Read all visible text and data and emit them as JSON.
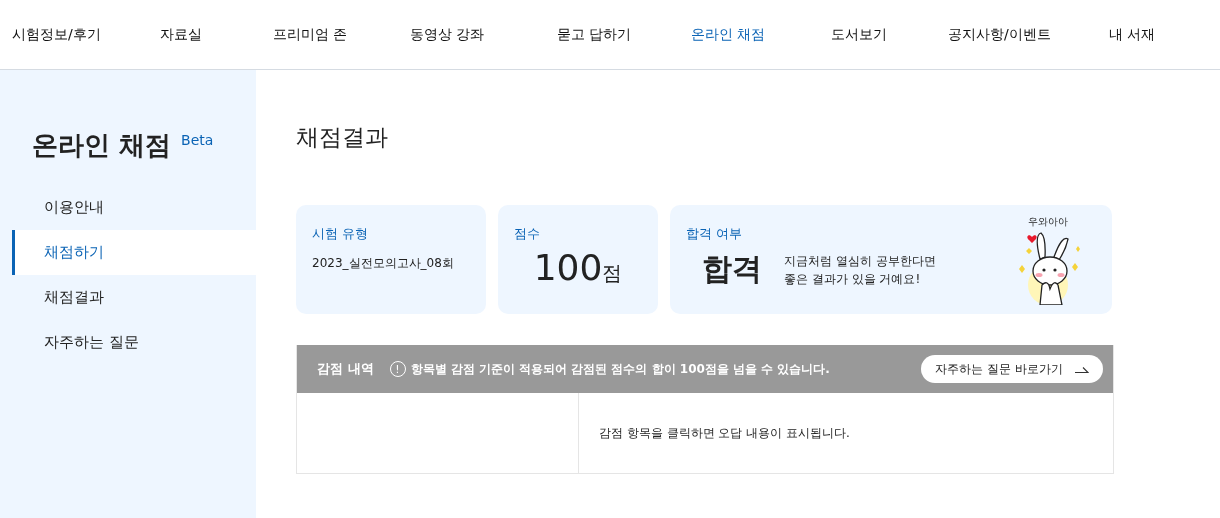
{
  "nav": [
    {
      "label": "시험정보/후기",
      "selected": false
    },
    {
      "label": "자료실",
      "selected": false
    },
    {
      "label": "프리미엄 존",
      "selected": false
    },
    {
      "label": "동영상 강좌",
      "selected": false
    },
    {
      "label": "묻고 답하기",
      "selected": false
    },
    {
      "label": "온라인 채점",
      "selected": true
    },
    {
      "label": "도서보기",
      "selected": false
    },
    {
      "label": "공지사항/이벤트",
      "selected": false
    },
    {
      "label": "내 서재",
      "selected": false
    }
  ],
  "sidebar": {
    "title": "온라인 채점",
    "badge": "Beta",
    "items": [
      {
        "label": "이용안내",
        "selected": false
      },
      {
        "label": "채점하기",
        "selected": true
      },
      {
        "label": "채점결과",
        "selected": false
      },
      {
        "label": "자주하는 질문",
        "selected": false
      }
    ]
  },
  "page_title": "채점결과",
  "cards": {
    "exam_type": {
      "label": "시험 유형",
      "value": "2023_실전모의고사_08회"
    },
    "score": {
      "label": "점수",
      "value": "100",
      "unit": "점"
    },
    "result": {
      "label": "합격 여부",
      "verdict": "합격",
      "message": "지금처럼 열심히 공부한다면\n좋은 결과가 있을 거예요!",
      "sticker_caption": "우와아아"
    }
  },
  "deductions": {
    "title": "감점 내역",
    "notice_icon": "!",
    "notice": "항목별 감점 기준이 적용되어 감점된 점수의 합이 100점을 넘을 수 있습니다.",
    "faq_button": "자주하는 질문 바로가기",
    "placeholder": "감점 항목을 클릭하면 오답 내용이 표시됩니다."
  }
}
